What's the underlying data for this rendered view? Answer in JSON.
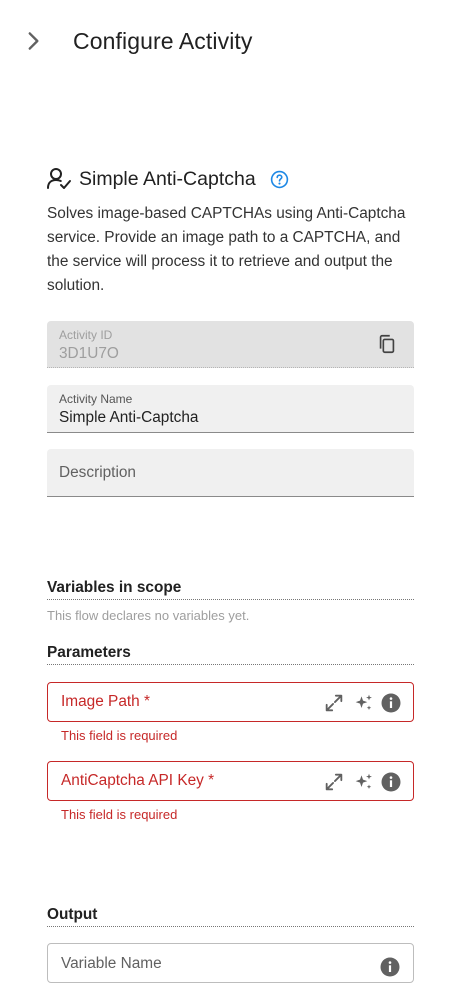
{
  "header": {
    "title": "Configure Activity"
  },
  "activity": {
    "name": "Simple Anti-Captcha",
    "description": "Solves image-based CAPTCHAs using Anti-Captcha service. Provide an image path to a CAPTCHA, and the service will process it to retrieve and output the solution."
  },
  "fields": {
    "activity_id_label": "Activity ID",
    "activity_id_value": "3D1U7O",
    "activity_name_label": "Activity Name",
    "activity_name_value": "Simple Anti-Captcha",
    "description_placeholder": "Description"
  },
  "variables": {
    "title": "Variables in scope",
    "empty_text": "This flow declares no variables yet."
  },
  "parameters": {
    "title": "Parameters",
    "items": [
      {
        "label": "Image Path *",
        "error": "This field is required"
      },
      {
        "label": "AntiCaptcha API Key *",
        "error": "This field is required"
      }
    ]
  },
  "output": {
    "title": "Output",
    "placeholder": "Variable Name"
  },
  "colors": {
    "error": "#c62828",
    "help": "#1e88e5",
    "icon": "#616161"
  }
}
